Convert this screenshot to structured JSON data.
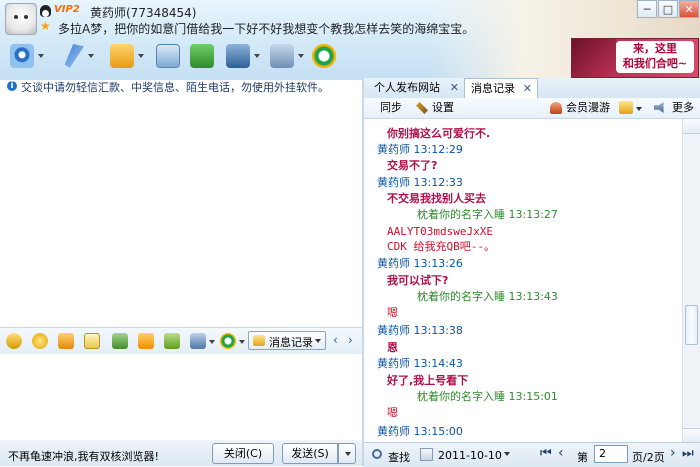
{
  "header": {
    "vip_badge": "VIP2",
    "contact_name": "黄药师(77348454)",
    "signature": "多拉A梦，把你的如意门借给我一下好不好我想变个教我怎样去笑的海绵宝宝。",
    "ad": {
      "line1": "来，这里",
      "line2": "和我们合吧~"
    }
  },
  "window_buttons": [
    "─",
    "□",
    "✕"
  ],
  "toolbar_icons": [
    "video-call-icon",
    "voice-call-icon",
    "send-file-icon",
    "send-email-icon",
    "create-group-icon",
    "remote-assist-icon",
    "app-settings-icon",
    "s-plugin-icon"
  ],
  "warning": {
    "text": "交谈中请勿轻信汇款、中奖信息、陌生电话，勿使用外挂软件。"
  },
  "left_toolbar": {
    "icons": [
      "font-icon",
      "emoji-icon",
      "shake-icon",
      "scribble-icon",
      "image-icon",
      "music-icon",
      "magic-icon",
      "screenshot-icon",
      "s-app-icon"
    ],
    "message_record_label": "消息记录"
  },
  "bottom": {
    "promo_text": "不再龟速冲浪,我有双核浏览器!",
    "close_label": "关闭(C)",
    "send_label": "发送(S)"
  },
  "right_panel": {
    "tabs": [
      {
        "label": "个人发布网站"
      },
      {
        "label": "消息记录"
      }
    ],
    "toolbar": {
      "sync_label": "同步",
      "settings_label": "设置",
      "roaming_label": "会员漫游",
      "more_label": "更多"
    },
    "history": [
      {
        "kind": "msg",
        "text": "你别搞这么可爱行不."
      },
      {
        "kind": "hdr",
        "text": "黄药师  13:12:29"
      },
      {
        "kind": "msg",
        "text": "交易不了?"
      },
      {
        "kind": "hdr",
        "text": "黄药师  13:12:33"
      },
      {
        "kind": "msg",
        "text": "不交易我找别人买去"
      },
      {
        "kind": "hdr2",
        "text": "枕着你的名字入睡  13:13:27"
      },
      {
        "kind": "mono",
        "text": "AALYT03mdsweJxXE"
      },
      {
        "kind": "mono",
        "text": "CDK  给我充QB吧--。"
      },
      {
        "kind": "hdr",
        "text": "黄药师  13:13:26"
      },
      {
        "kind": "msg",
        "text": "我可以试下?"
      },
      {
        "kind": "hdr2",
        "text": "枕着你的名字入睡  13:13:43"
      },
      {
        "kind": "msg-r",
        "text": "嗯"
      },
      {
        "kind": "hdr",
        "text": "黄药师  13:13:38"
      },
      {
        "kind": "msg",
        "text": "恩"
      },
      {
        "kind": "hdr",
        "text": "黄药师  13:14:43"
      },
      {
        "kind": "msg",
        "text": "好了,我上号看下"
      },
      {
        "kind": "hdr2",
        "text": "枕着你的名字入睡  13:15:01"
      },
      {
        "kind": "msg-r",
        "text": "嗯"
      },
      {
        "kind": "hdr",
        "text": "黄药师  13:15:00"
      }
    ],
    "bottom": {
      "find_label": "查找",
      "date": "2011-10-10",
      "page_prefix": "第",
      "page_value": "2",
      "page_suffix": "页/2页"
    }
  }
}
